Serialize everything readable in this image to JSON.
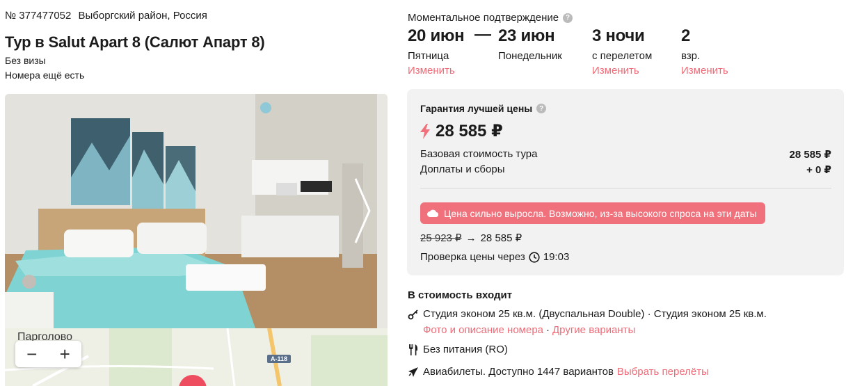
{
  "tour": {
    "id": "№ 377477052",
    "region": "Выборгский район, Россия",
    "title": "Тур в Salut Apart 8 (Салют Апарт 8)",
    "visa": "Без визы",
    "availability": "Номера ещё есть"
  },
  "map": {
    "city": "Парголово",
    "zoom_out": "−",
    "zoom_in": "+",
    "road": "А-118"
  },
  "booking": {
    "confirm_label": "Моментальное подтверждение",
    "help": "?",
    "date_from": "20 июн",
    "date_from_day": "Пятница",
    "date_to": "23 июн",
    "date_to_day": "Понедельник",
    "dash": "—",
    "nights": "3 ночи",
    "nights_sub": "с перелетом",
    "guests": "2",
    "guests_sub": "взр.",
    "change": "Изменить"
  },
  "price": {
    "guarantee": "Гарантия лучшей цены",
    "total": "28 585 ₽",
    "base_label": "Базовая стоимость тура",
    "base_value": "28 585 ₽",
    "extra_label": "Доплаты и сборы",
    "extra_value": "+ 0 ₽",
    "alert": "Цена сильно выросла. Возможно, из-за высокого спроса на эти даты",
    "old": "25 923 ₽",
    "arrow": "→",
    "new": "28 585 ₽",
    "check_label": "Проверка цены через",
    "check_time": "19:03",
    "accent": "#f0707b"
  },
  "includes": {
    "title": "В стоимость входит",
    "room": "Студия эконом 25 кв.м. (Двуспальная Double) · Студия эконом 25 кв.м.",
    "room_photos": "Фото и описание номера",
    "sep": "·",
    "room_other": "Другие варианты",
    "meal": "Без питания (RO)",
    "flights": "Авиабилеты. Доступно 1447 вариантов",
    "flights_link": "Выбрать перелёты"
  }
}
